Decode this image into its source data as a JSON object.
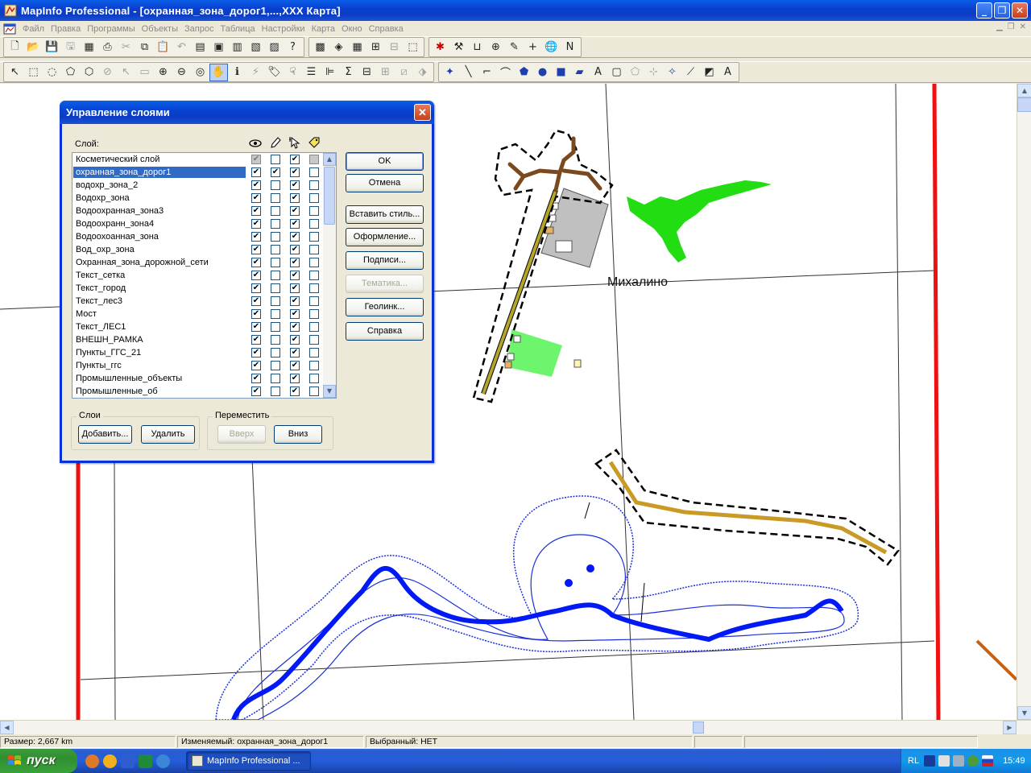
{
  "window": {
    "title": "MapInfo Professional - [охранная_зона_дорог1,...,XXX Карта]",
    "min_glyph": "_",
    "max_glyph": "❐",
    "close_glyph": "✕"
  },
  "menu": [
    "Файл",
    "Правка",
    "Программы",
    "Объекты",
    "Запрос",
    "Таблица",
    "Настройки",
    "Карта",
    "Окно",
    "Справка"
  ],
  "map": {
    "place_label": "Михалино"
  },
  "dialog": {
    "title": "Управление слоями",
    "close_glyph": "✕",
    "layer_header": "Слой:",
    "layers": [
      {
        "name": "Косметический слой",
        "visible": true,
        "editable": false,
        "selectable": true,
        "labels": false,
        "greyed": true
      },
      {
        "name": "охранная_зона_дорог1",
        "visible": true,
        "editable": true,
        "selectable": true,
        "labels": false,
        "selected": true
      },
      {
        "name": "водохр_зона_2",
        "visible": true,
        "editable": false,
        "selectable": true,
        "labels": false
      },
      {
        "name": "Водохр_зона",
        "visible": true,
        "editable": false,
        "selectable": true,
        "labels": false
      },
      {
        "name": "Водоохранная_зона3",
        "visible": true,
        "editable": false,
        "selectable": true,
        "labels": false
      },
      {
        "name": "Водоохранн_зона4",
        "visible": true,
        "editable": false,
        "selectable": true,
        "labels": false
      },
      {
        "name": "Водоохоанная_зона",
        "visible": true,
        "editable": false,
        "selectable": true,
        "labels": false
      },
      {
        "name": "Вод_охр_зона",
        "visible": true,
        "editable": false,
        "selectable": true,
        "labels": false
      },
      {
        "name": "Охранная_зона_дорожной_сети",
        "visible": true,
        "editable": false,
        "selectable": true,
        "labels": false
      },
      {
        "name": "Текст_сетка",
        "visible": true,
        "editable": false,
        "selectable": true,
        "labels": false
      },
      {
        "name": "Текст_город",
        "visible": true,
        "editable": false,
        "selectable": true,
        "labels": false
      },
      {
        "name": "Текст_лес3",
        "visible": true,
        "editable": false,
        "selectable": true,
        "labels": false
      },
      {
        "name": "Мост",
        "visible": true,
        "editable": false,
        "selectable": true,
        "labels": false
      },
      {
        "name": "Текст_ЛЕС1",
        "visible": true,
        "editable": false,
        "selectable": true,
        "labels": false
      },
      {
        "name": "ВНЕШН_РАМКА",
        "visible": true,
        "editable": false,
        "selectable": true,
        "labels": false
      },
      {
        "name": "Пункты_ГГС_21",
        "visible": true,
        "editable": false,
        "selectable": true,
        "labels": false
      },
      {
        "name": "Пункты_ггс",
        "visible": true,
        "editable": false,
        "selectable": true,
        "labels": false
      },
      {
        "name": "Промышленные_объекты",
        "visible": true,
        "editable": false,
        "selectable": true,
        "labels": false
      },
      {
        "name": "Промышленные_об",
        "visible": true,
        "editable": false,
        "selectable": true,
        "labels": false
      }
    ],
    "buttons": {
      "ok": "OK",
      "cancel": "Отмена",
      "insert_style": "Вставить стиль...",
      "display": "Оформление...",
      "labels": "Подписи...",
      "thematic": "Тематика...",
      "geolink": "Геолинк...",
      "help": "Справка"
    },
    "layers_group": {
      "caption": "Слои",
      "add": "Добавить...",
      "remove": "Удалить"
    },
    "move_group": {
      "caption": "Переместить",
      "up": "Вверх",
      "down": "Вниз"
    }
  },
  "status": {
    "size": "Размер: 2,667 km",
    "editable": "Изменяемый: охранная_зона_дорог1",
    "selected": "Выбранный: НЕТ"
  },
  "taskbar": {
    "start": "пуск",
    "task": "MapInfo Professional ...",
    "lang": "RL",
    "clock": "15:49"
  },
  "colors": {
    "road_outline": "#000000",
    "road_fill": "#b5a52a",
    "road_brown": "#7a4a1e",
    "forest": "#22dd11",
    "river": "#0019f5",
    "frame_red": "#ee1111",
    "selection": "#316ac5"
  }
}
